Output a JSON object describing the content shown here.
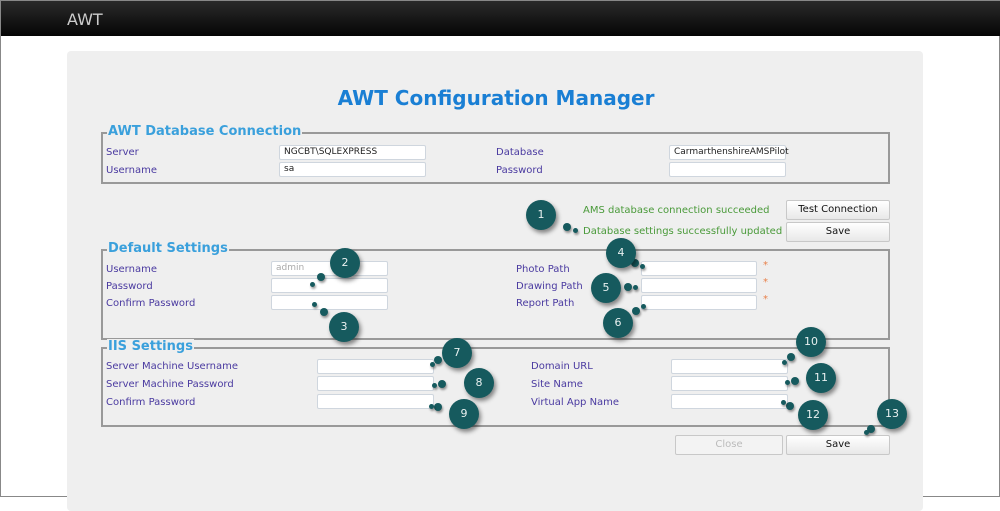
{
  "app": {
    "brand": "AWT"
  },
  "title": "AWT Configuration Manager",
  "db": {
    "legend": "AWT Database Connection",
    "server_label": "Server",
    "server": "NGCBT\\SQLEXPRESS",
    "username_label": "Username",
    "username": "sa",
    "database_label": "Database",
    "database": "CarmarthenshireAMSPilot",
    "password_label": "Password",
    "password": ""
  },
  "status": {
    "msg1": "AMS database connection succeeded",
    "msg2": "Database settings successfully updated",
    "test_button": "Test Connection",
    "save_button": "Save"
  },
  "defaults": {
    "legend": "Default Settings",
    "username_label": "Username",
    "username_placeholder": "admin",
    "password_label": "Password",
    "confirm_label": "Confirm Password",
    "photo_label": "Photo Path",
    "drawing_label": "Drawing Path",
    "report_label": "Report Path",
    "required": "*"
  },
  "iis": {
    "legend": "IIS Settings",
    "user_label": "Server Machine Username",
    "pass_label": "Server Machine Password",
    "confirm_label": "Confirm Password",
    "domain_label": "Domain URL",
    "site_label": "Site Name",
    "vapp_label": "Virtual App Name"
  },
  "footer": {
    "close_button": "Close",
    "save_button": "Save"
  },
  "callouts": [
    "1",
    "2",
    "3",
    "4",
    "5",
    "6",
    "7",
    "8",
    "9",
    "10",
    "11",
    "12",
    "13"
  ]
}
